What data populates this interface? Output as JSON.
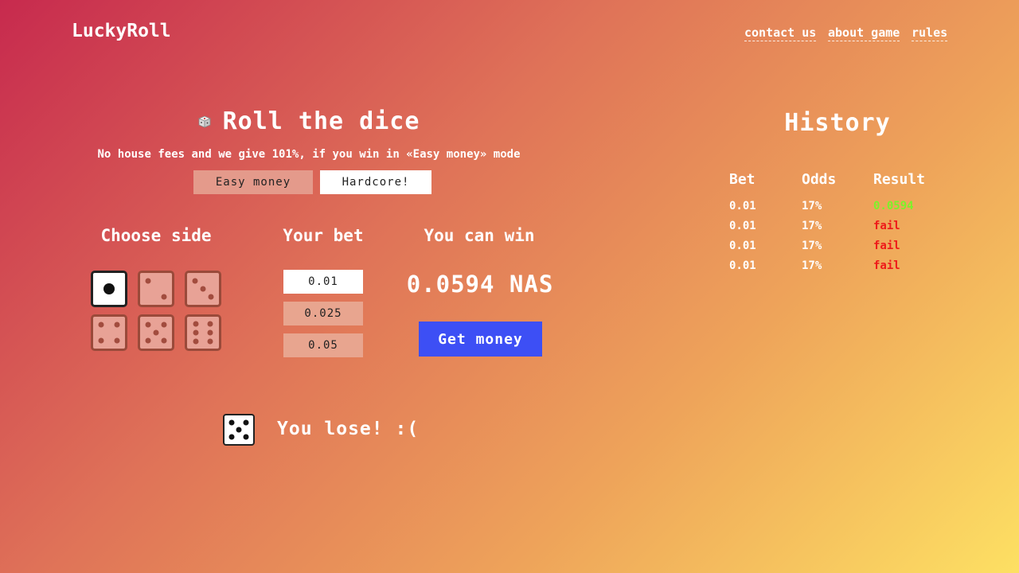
{
  "header": {
    "logo": "LuckyRoll",
    "nav": [
      "contact us",
      "about game",
      "rules"
    ]
  },
  "game": {
    "title": "Roll the dice",
    "title_icon": "dice-icon",
    "subtitle": "No house fees and we give 101%, if you win in «Easy money» mode",
    "modes": [
      "Easy money",
      "Hardcore!"
    ],
    "active_mode": "Hardcore!",
    "choose_side_label": "Choose side",
    "selected_side": 1,
    "sides": [
      1,
      2,
      3,
      4,
      5,
      6
    ],
    "your_bet_label": "Your bet",
    "bets": [
      "0.01",
      "0.025",
      "0.05"
    ],
    "selected_bet": "0.01",
    "you_can_win_label": "You can win",
    "win_amount": "0.0594 NAS",
    "get_money_label": "Get money",
    "result_face": 5,
    "result_text": "You lose! :("
  },
  "history": {
    "title": "History",
    "columns": [
      "Bet",
      "Odds",
      "Result"
    ],
    "rows": [
      {
        "bet": "0.01",
        "odds": "17%",
        "result": "0.0594",
        "status": "win"
      },
      {
        "bet": "0.01",
        "odds": "17%",
        "result": "fail",
        "status": "fail"
      },
      {
        "bet": "0.01",
        "odds": "17%",
        "result": "fail",
        "status": "fail"
      },
      {
        "bet": "0.01",
        "odds": "17%",
        "result": "fail",
        "status": "fail"
      }
    ]
  },
  "colors": {
    "accent_button": "#3d4ff5",
    "win": "#7cf22a",
    "fail": "#ee1a1a",
    "gradient_start": "#c72a4e",
    "gradient_end": "#fde063"
  }
}
